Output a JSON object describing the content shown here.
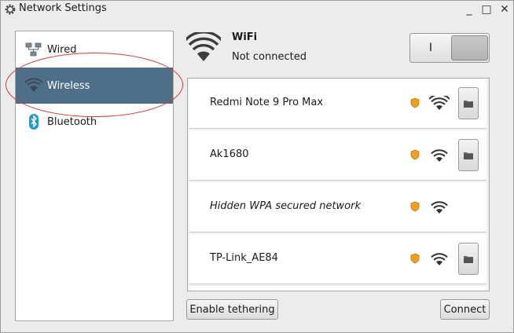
{
  "window": {
    "title": "Network Settings",
    "controls": {
      "minimize": "_",
      "maximize": "□",
      "close": "✕"
    }
  },
  "sidebar": {
    "items": [
      {
        "label": "Wired",
        "icon": "wired-network-icon",
        "selected": false
      },
      {
        "label": "Wireless",
        "icon": "wifi-icon",
        "selected": true
      },
      {
        "label": "Bluetooth",
        "icon": "bluetooth-icon",
        "selected": false
      }
    ]
  },
  "header": {
    "title": "WiFi",
    "status": "Not connected",
    "toggle_on_label": "I",
    "toggle_state": "off"
  },
  "networks": [
    {
      "name": "Redmi Note 9 Pro Max",
      "secured": true,
      "signal": "full",
      "has_settings": true,
      "hidden": false
    },
    {
      "name": "Ak1680",
      "secured": true,
      "signal": "good",
      "has_settings": true,
      "hidden": false
    },
    {
      "name": "Hidden WPA secured network",
      "secured": true,
      "signal": "good",
      "has_settings": false,
      "hidden": true
    },
    {
      "name": "TP-Link_AE84",
      "secured": true,
      "signal": "good",
      "has_settings": true,
      "hidden": false
    }
  ],
  "buttons": {
    "tether": "Enable tethering",
    "connect": "Connect"
  },
  "colors": {
    "selection": "#4f6f88",
    "shield": "#f0a020",
    "annotation": "#d33a3a"
  }
}
